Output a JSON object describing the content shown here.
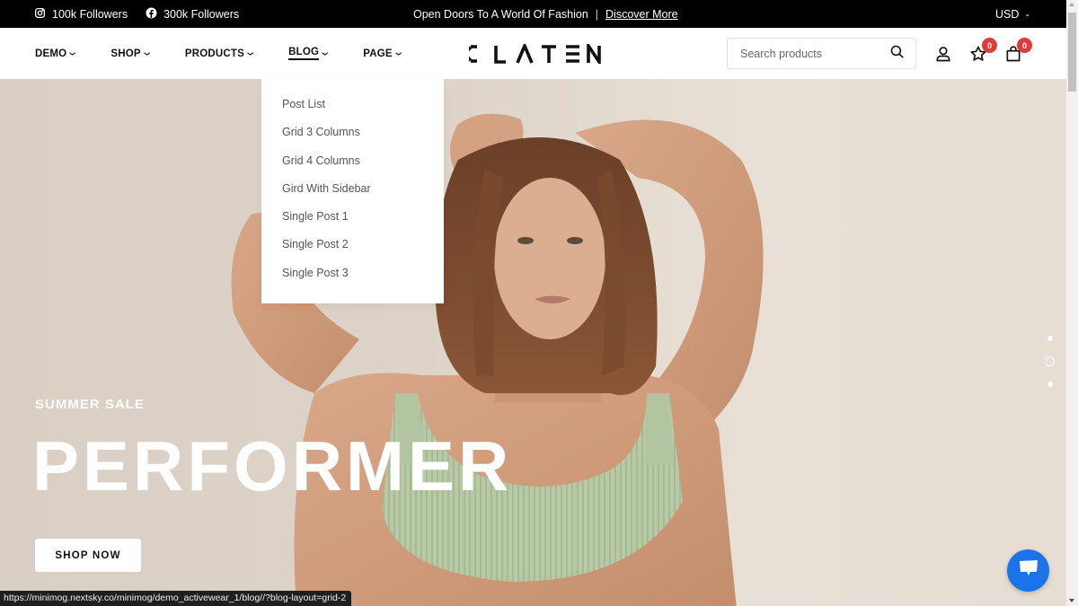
{
  "topbar": {
    "social": [
      {
        "icon": "instagram-icon",
        "label": "100k Followers"
      },
      {
        "icon": "facebook-icon",
        "label": "300k Followers"
      }
    ],
    "promo_text": "Open Doors To A World Of Fashion",
    "promo_separator": "|",
    "promo_link": "Discover More",
    "currency": "USD"
  },
  "header": {
    "nav": [
      {
        "label": "DEMO",
        "active": false
      },
      {
        "label": "SHOP",
        "active": false
      },
      {
        "label": "PRODUCTS",
        "active": false
      },
      {
        "label": "BLOG",
        "active": true
      },
      {
        "label": "PAGE",
        "active": false
      }
    ],
    "logo": "CLATEN",
    "search_placeholder": "Search products",
    "wishlist_count": "0",
    "cart_count": "0"
  },
  "blog_dropdown": {
    "items": [
      "Post List",
      "Grid 3 Columns",
      "Grid 4 Columns",
      "Gird With Sidebar",
      "Single Post 1",
      "Single Post 2",
      "Single Post 3"
    ]
  },
  "hero": {
    "subtitle": "SUMMER SALE",
    "title": "PERFORMER",
    "cta": "SHOP NOW",
    "slides_total": 3,
    "active_slide": 2
  },
  "status_url": "https://minimog.nextsky.co/minimog/demo_activewear_1/blog//?blog-layout=grid-2",
  "colors": {
    "topbar_bg": "#000000",
    "badge": "#e03a3a",
    "chat_button": "#1a73e8",
    "hero_bg": "#e0d7cd"
  }
}
